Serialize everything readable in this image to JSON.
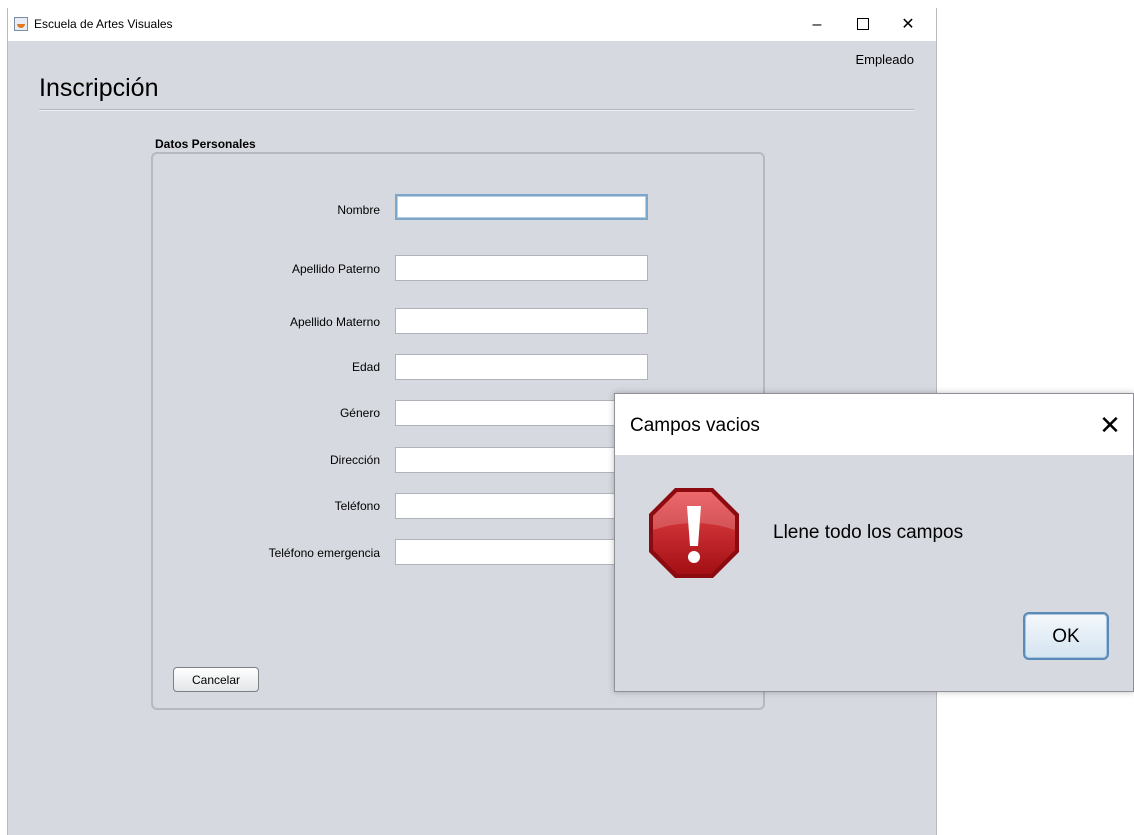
{
  "window": {
    "title": "Escuela de Artes Visuales",
    "minimize_glyph": "–",
    "close_glyph": "✕"
  },
  "header": {
    "user_label": "Empleado",
    "page_title": "Inscripción"
  },
  "form": {
    "section_label": "Datos Personales",
    "fields": [
      {
        "label": "Nombre",
        "value": ""
      },
      {
        "label": "Apellido Paterno",
        "value": ""
      },
      {
        "label": "Apellido Materno",
        "value": ""
      },
      {
        "label": "Edad",
        "value": ""
      },
      {
        "label": "Género",
        "value": ""
      },
      {
        "label": "Dirección",
        "value": ""
      },
      {
        "label": "Teléfono",
        "value": ""
      },
      {
        "label": "Teléfono emergencia",
        "value": ""
      }
    ],
    "cancel_label": "Cancelar"
  },
  "dialog": {
    "title": "Campos vacios",
    "close_glyph": "✕",
    "message": "Llene todo los campos",
    "ok_label": "OK",
    "icon": "error-icon",
    "icon_color": "#c4161c"
  }
}
